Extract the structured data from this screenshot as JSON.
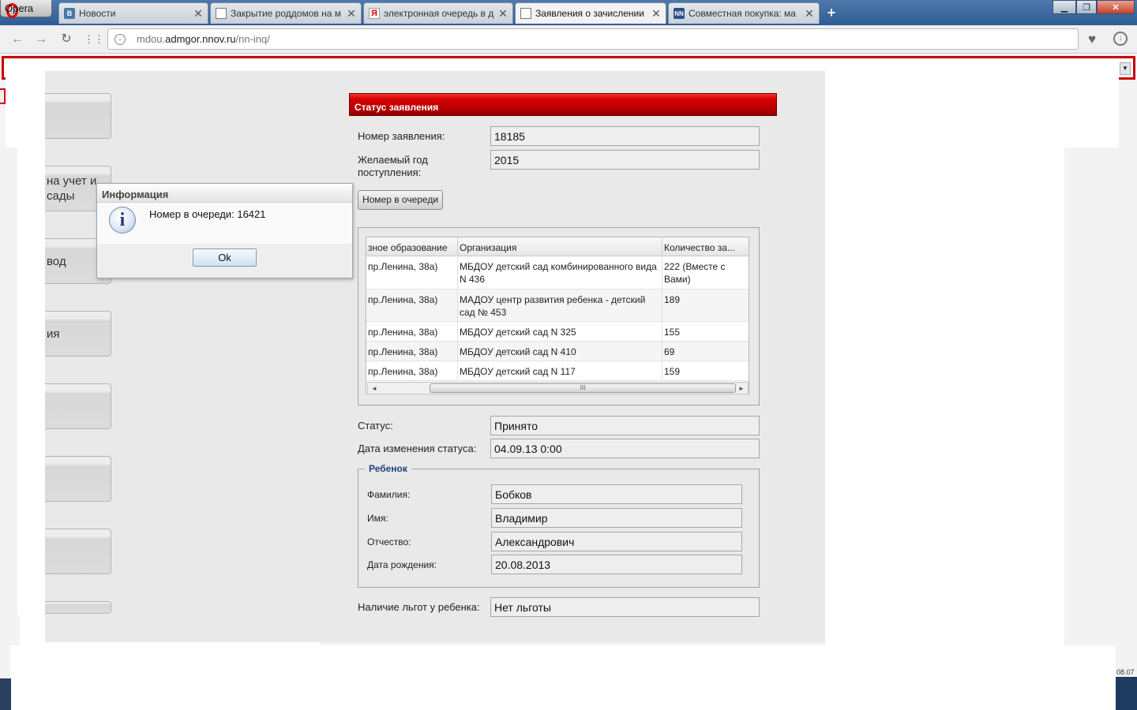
{
  "browser": {
    "menu_label": "Opera",
    "tabs": [
      {
        "title": "Новости",
        "icon": "vk-icon"
      },
      {
        "title": "Закрытие роддомов на м",
        "icon": "document-icon"
      },
      {
        "title": "электронная очередь в д",
        "icon": "yandex-icon"
      },
      {
        "title": "Заявления о зачислении",
        "icon": "document-icon",
        "active": true
      },
      {
        "title": "Совместная покупка: ма",
        "icon": "nn-icon"
      }
    ],
    "favicon_text": {
      "vk": "B",
      "yandex": "Я",
      "nn": "NN"
    },
    "new_tab": "+",
    "url_host": "mdou.admgor.nnov.ru",
    "url_prefix": "mdou.",
    "url_domain": "admgor.nnov.ru",
    "url_path": "/nn-inq/"
  },
  "sidebar": {
    "buttons": [
      {
        "label": ""
      },
      {
        "label": "на учет и\nсады"
      },
      {
        "label": "вод"
      },
      {
        "label": "ия"
      },
      {
        "label": ""
      },
      {
        "label": ""
      },
      {
        "label": ""
      },
      {
        "label": ""
      }
    ]
  },
  "status_panel": {
    "title": "Статус заявления",
    "application_number_label": "Номер заявления:",
    "application_number": "18185",
    "desired_year_label": "Желаемый год поступления:",
    "desired_year": "2015",
    "queue_button": "Номер в очереди",
    "grid": {
      "columns": [
        "зное образование",
        "Организация",
        "Количество за..."
      ],
      "rows": [
        [
          "пр.Ленина, 38а)",
          "МБДОУ детский сад комбинированного вида N 436",
          "222 (Вместе с Вами)"
        ],
        [
          "пр.Ленина, 38а)",
          "МАДОУ центр развития ребенка - детский сад № 453",
          "189"
        ],
        [
          "пр.Ленина, 38а)",
          "МБДОУ детский сад N 325",
          "155"
        ],
        [
          "пр.Ленина, 38а)",
          "МБДОУ детский сад N 410",
          "69"
        ],
        [
          "пр.Ленина, 38а)",
          "МБДОУ детский сад N 117",
          "159"
        ]
      ],
      "scroll_left": "◄",
      "scroll_right": "►",
      "scroll_grip": "III"
    },
    "status_label": "Статус:",
    "status": "Принято",
    "status_date_label": "Дата изменения статуса:",
    "status_date": "04.09.13 0:00",
    "child": {
      "legend": "Ребенок",
      "surname_label": "Фамилия:",
      "surname": "Бобков",
      "name_label": "Имя:",
      "name": "Владимир",
      "patronymic_label": "Отчество:",
      "patronymic": "Александрович",
      "birthdate_label": "Дата рождения:",
      "birthdate": "20.08.2013"
    },
    "benefits_label": "Наличие льгот у ребенка:",
    "benefits": "Нет льготы"
  },
  "dialog": {
    "title": "Информация",
    "message": "Номер в очереди: 16421",
    "ok": "Ok",
    "icon_glyph": "i"
  },
  "clock": "08.07",
  "colors": {
    "panel_header": "#c00000",
    "frame_red": "#cc0000",
    "legend": "#1f3f7f",
    "tabbar": "#3b659c"
  }
}
